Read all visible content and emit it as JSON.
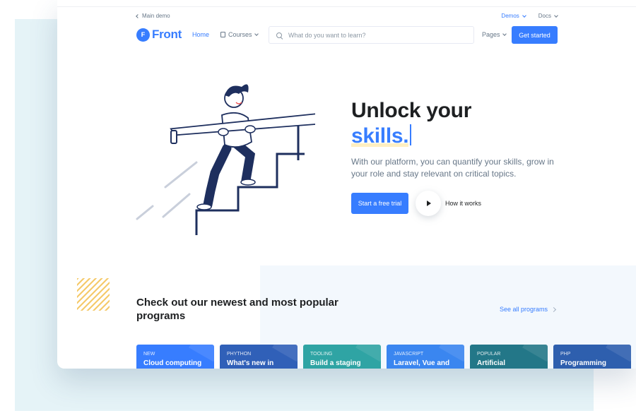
{
  "topbar": {
    "back_label": "Main demo",
    "demos_label": "Demos",
    "docs_label": "Docs"
  },
  "navbar": {
    "logo_mark": "F",
    "logo_text": "Front",
    "home_label": "Home",
    "courses_label": "Courses",
    "search_placeholder": "What do you want to learn?",
    "pages_label": "Pages",
    "get_started_label": "Get started"
  },
  "hero": {
    "title_line1": "Unlock your",
    "title_highlight": "skills.",
    "description": "With our platform, you can quantify your skills, grow in your role and stay relevant on critical topics.",
    "trial_label": "Start a free trial",
    "how_label": "How it works"
  },
  "programs": {
    "heading": "Check out our newest and most popular programs",
    "see_all_label": "See all programs",
    "cards": [
      {
        "category": "New",
        "title": "Cloud computing",
        "color": "#377dff"
      },
      {
        "category": "Phython",
        "title": "What's new in",
        "color": "#3060b8"
      },
      {
        "category": "Tooling",
        "title": "Build a staging",
        "color": "#2fa4a4"
      },
      {
        "category": "JavaScript",
        "title": "Laravel, Vue and",
        "color": "#3a86f0"
      },
      {
        "category": "Popular",
        "title": "Artificial",
        "color": "#237788"
      },
      {
        "category": "PHP",
        "title": "Programming",
        "color": "#2e5fae"
      }
    ]
  },
  "colors": {
    "primary": "#377dff",
    "heading": "#1e2022",
    "body_text": "#677788",
    "illustration_navy": "#1e2f5e",
    "accent_yellow": "#f5ca6b"
  }
}
